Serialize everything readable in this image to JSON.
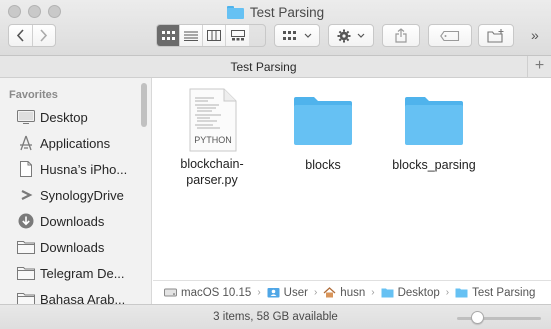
{
  "window": {
    "title": "Test Parsing",
    "path_header": "Test Parsing"
  },
  "toolbar": {
    "more_label": "»",
    "icon_size_fraction": 0.24
  },
  "sidebar": {
    "section_title": "Favorites",
    "items": [
      {
        "label": "Desktop",
        "icon": "desktop-icon"
      },
      {
        "label": "Applications",
        "icon": "applications-icon"
      },
      {
        "label": "Husna’s iPho...",
        "icon": "document-icon"
      },
      {
        "label": "SynologyDrive",
        "icon": "synology-icon"
      },
      {
        "label": "Downloads",
        "icon": "downloads-icon"
      },
      {
        "label": "Downloads",
        "icon": "folder-icon"
      },
      {
        "label": "Telegram De...",
        "icon": "folder-icon"
      },
      {
        "label": "Bahasa Arab...",
        "icon": "folder-icon"
      }
    ]
  },
  "files": [
    {
      "name": "blockchain-parser.py",
      "line1": "blockchain-",
      "line2": "parser.py",
      "badge": "PYTHON",
      "type": "python-file"
    },
    {
      "name": "blocks",
      "line1": "blocks",
      "line2": "",
      "type": "folder"
    },
    {
      "name": "blocks_parsing",
      "line1": "blocks_parsing",
      "line2": "",
      "type": "folder"
    }
  ],
  "pathbar": {
    "crumbs": [
      "macOS 10.15",
      "User",
      "husn",
      "Desktop",
      "Test Parsing"
    ]
  },
  "status": {
    "text": "3 items, 58 GB available"
  },
  "colors": {
    "folder": "#66c1f3",
    "folder_dark": "#4fb3ec",
    "accent": "#1a82ff"
  }
}
